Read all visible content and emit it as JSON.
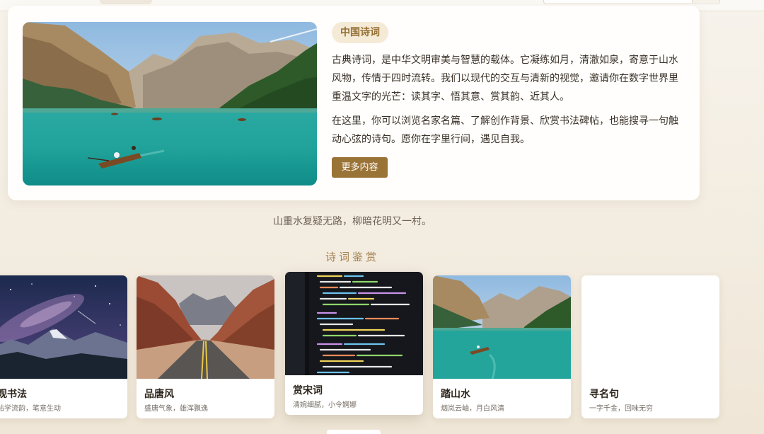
{
  "hero": {
    "tag": "中国诗词",
    "para1": "古典诗词，是中华文明审美与智慧的载体。它凝练如月，清澈如泉，寄意于山水风物，传情于四时流转。我们以现代的交互与清新的视觉，邀请你在数字世界里重温文字的光芒：读其字、悟其意、赏其韵、近其人。",
    "para2": "在这里，你可以浏览名家名篇、了解创作背景、欣赏书法碑帖，也能搜寻一句触动心弦的诗句。愿你在字里行间，遇见自我。",
    "more_label": "更多内容"
  },
  "quote": "山重水复疑无路，柳暗花明又一村。",
  "section_title": "诗词鉴赏",
  "cards": [
    {
      "title": "观书法",
      "subtitle": "帖学流韵，笔意生动",
      "image": "starry-mountain"
    },
    {
      "title": "品唐风",
      "subtitle": "盛唐气象，雄浑飘逸",
      "image": "canyon-road"
    },
    {
      "title": "赏宋词",
      "subtitle": "清婉细腻，小令婀娜",
      "image": "code-screen"
    },
    {
      "title": "踏山水",
      "subtitle": "烟岚云岫，月白风清",
      "image": "lake-boat"
    },
    {
      "title": "寻名句",
      "subtitle": "一字千金，回味无穷",
      "image": ""
    }
  ],
  "colors": {
    "accent": "#9a7336",
    "tag_bg": "#f4ead6",
    "page_bg": "#f3ece0"
  }
}
